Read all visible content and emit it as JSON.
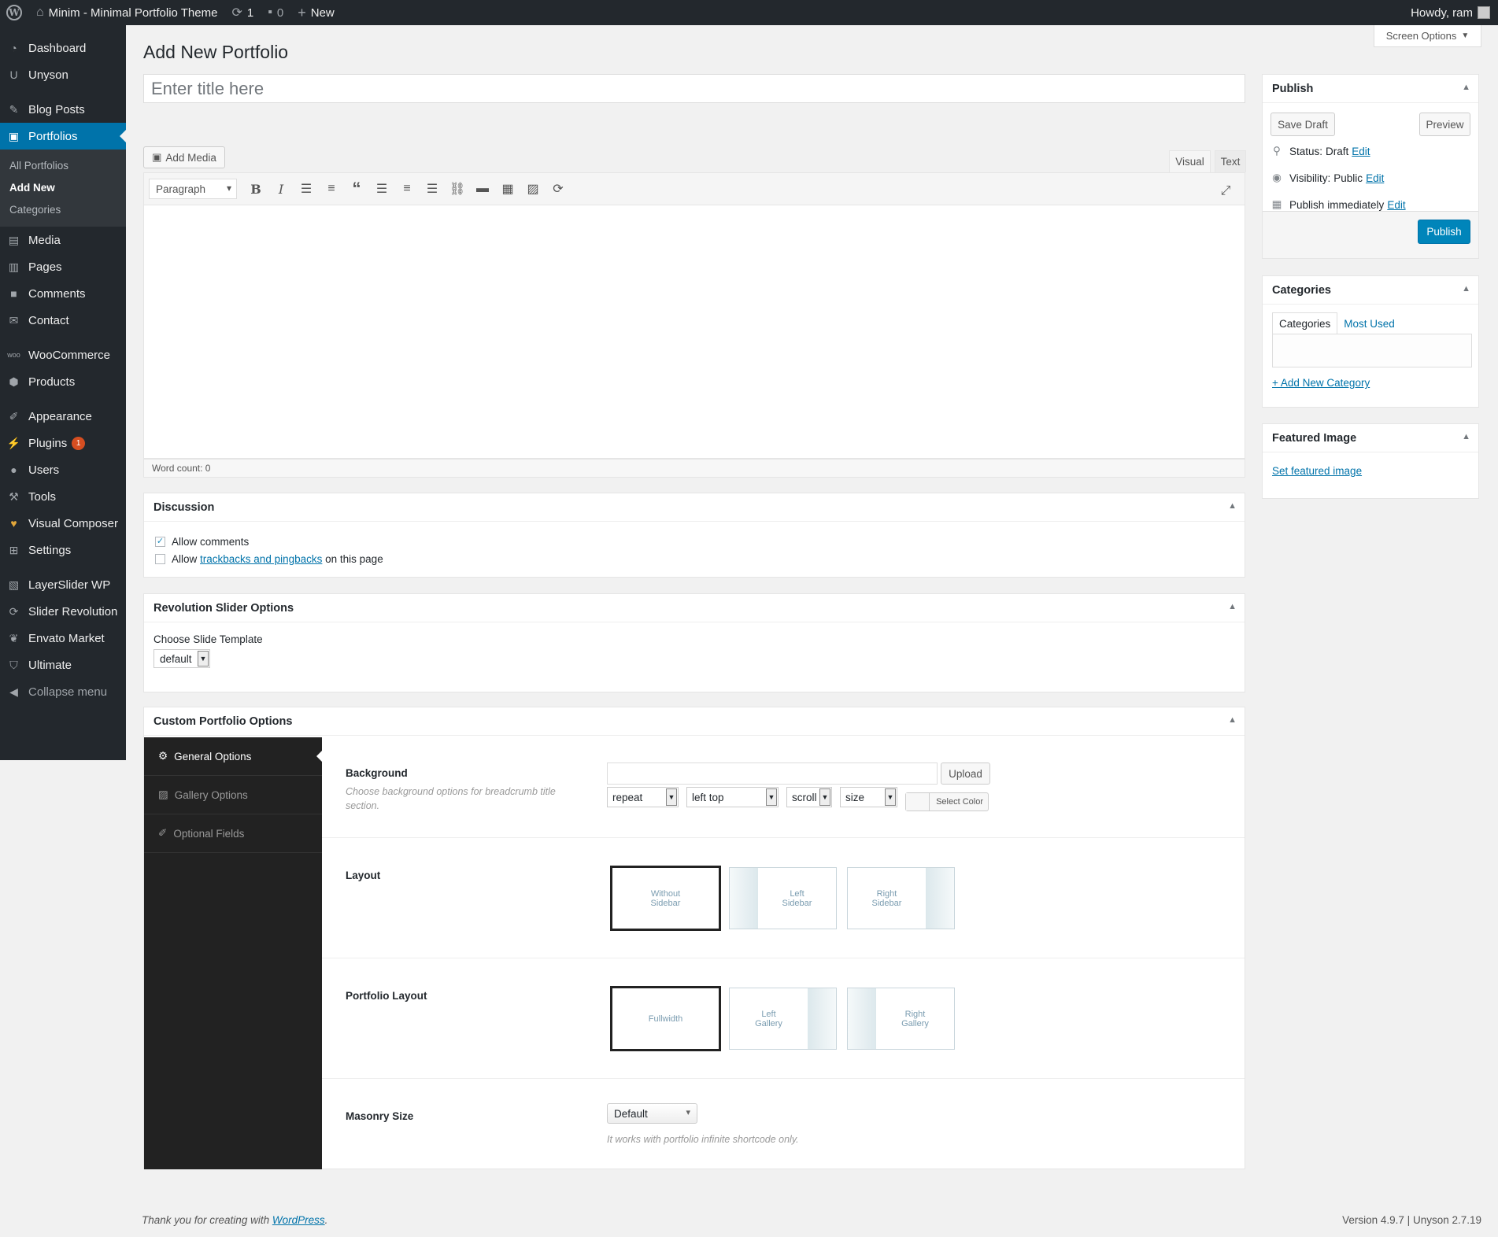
{
  "adminbar": {
    "site_name": "Minim - Minimal Portfolio Theme",
    "updates_count": "1",
    "comments_count": "0",
    "new_label": "New",
    "howdy": "Howdy, ram"
  },
  "sidebar": {
    "items": [
      {
        "label": "Dashboard",
        "icon": "dashboard-icon"
      },
      {
        "label": "Unyson",
        "icon": "unyson-icon"
      },
      {
        "label": "Blog Posts",
        "icon": "pin-icon"
      },
      {
        "label": "Portfolios",
        "icon": "portfolio-icon"
      },
      {
        "label": "Media",
        "icon": "media-icon"
      },
      {
        "label": "Pages",
        "icon": "pages-icon"
      },
      {
        "label": "Comments",
        "icon": "comments-icon"
      },
      {
        "label": "Contact",
        "icon": "mail-icon"
      },
      {
        "label": "WooCommerce",
        "icon": "woocommerce-icon"
      },
      {
        "label": "Products",
        "icon": "products-icon"
      },
      {
        "label": "Appearance",
        "icon": "brush-icon"
      },
      {
        "label": "Plugins",
        "icon": "plugin-icon",
        "badge": "1"
      },
      {
        "label": "Users",
        "icon": "users-icon"
      },
      {
        "label": "Tools",
        "icon": "wrench-icon"
      },
      {
        "label": "Visual Composer",
        "icon": "vc-icon"
      },
      {
        "label": "Settings",
        "icon": "settings-icon"
      },
      {
        "label": "LayerSlider WP",
        "icon": "layerslider-icon"
      },
      {
        "label": "Slider Revolution",
        "icon": "refresh-icon"
      },
      {
        "label": "Envato Market",
        "icon": "leaf-icon"
      },
      {
        "label": "Ultimate",
        "icon": "shield-icon"
      },
      {
        "label": "Collapse menu",
        "icon": "collapse-icon"
      }
    ],
    "submenu": [
      "All Portfolios",
      "Add New",
      "Categories"
    ]
  },
  "screen_options": "Screen Options",
  "page_title": "Add New Portfolio",
  "title_placeholder": "Enter title here",
  "editor": {
    "add_media": "Add Media",
    "tab_visual": "Visual",
    "tab_text": "Text",
    "format": "Paragraph",
    "word_count": "Word count: 0"
  },
  "discussion": {
    "title": "Discussion",
    "allow_comments": "Allow comments",
    "allow_comments_checked": true,
    "allow_pre": "Allow",
    "trackbacks_link": "trackbacks and pingbacks",
    "allow_post": "on this page"
  },
  "revslider": {
    "title": "Revolution Slider Options",
    "label": "Choose Slide Template",
    "value": "default"
  },
  "custom_options": {
    "title": "Custom Portfolio Options",
    "tabs": [
      "General Options",
      "Gallery Options",
      "Optional Fields"
    ],
    "background": {
      "title": "Background",
      "desc": "Choose background options for breadcrumb title section.",
      "upload": "Upload",
      "repeat": "repeat",
      "position": "left top",
      "attachment": "scroll",
      "size": "size",
      "select_color": "Select Color"
    },
    "layout": {
      "title": "Layout",
      "options": [
        "Without Sidebar",
        "Left Sidebar",
        "Right Sidebar"
      ]
    },
    "portfolio_layout": {
      "title": "Portfolio Layout",
      "options": [
        "Fullwidth",
        "Left Gallery",
        "Right Gallery"
      ]
    },
    "masonry": {
      "title": "Masonry Size",
      "value": "Default",
      "help": "It works with portfolio infinite shortcode only."
    }
  },
  "publish": {
    "title": "Publish",
    "save_draft": "Save Draft",
    "preview": "Preview",
    "status_label": "Status:",
    "status_value": "Draft",
    "visibility_label": "Visibility:",
    "visibility_value": "Public",
    "publish_label": "Publish",
    "publish_value": "immediately",
    "edit": "Edit",
    "publish_button": "Publish"
  },
  "categories": {
    "title": "Categories",
    "tab_all": "Categories",
    "tab_most_used": "Most Used",
    "add_new": "+ Add New Category"
  },
  "featured": {
    "title": "Featured Image",
    "link": "Set featured image"
  },
  "footer": {
    "thanks_pre": "Thank you for creating with",
    "wordpress_link": "WordPress",
    "thanks_post": ".",
    "version": "Version 4.9.7 | Unyson 2.7.19"
  },
  "colors": {
    "admin_dark": "#23282d",
    "accent_blue": "#0073aa",
    "publish_blue": "#0085ba",
    "badge_orange": "#d54e21"
  }
}
